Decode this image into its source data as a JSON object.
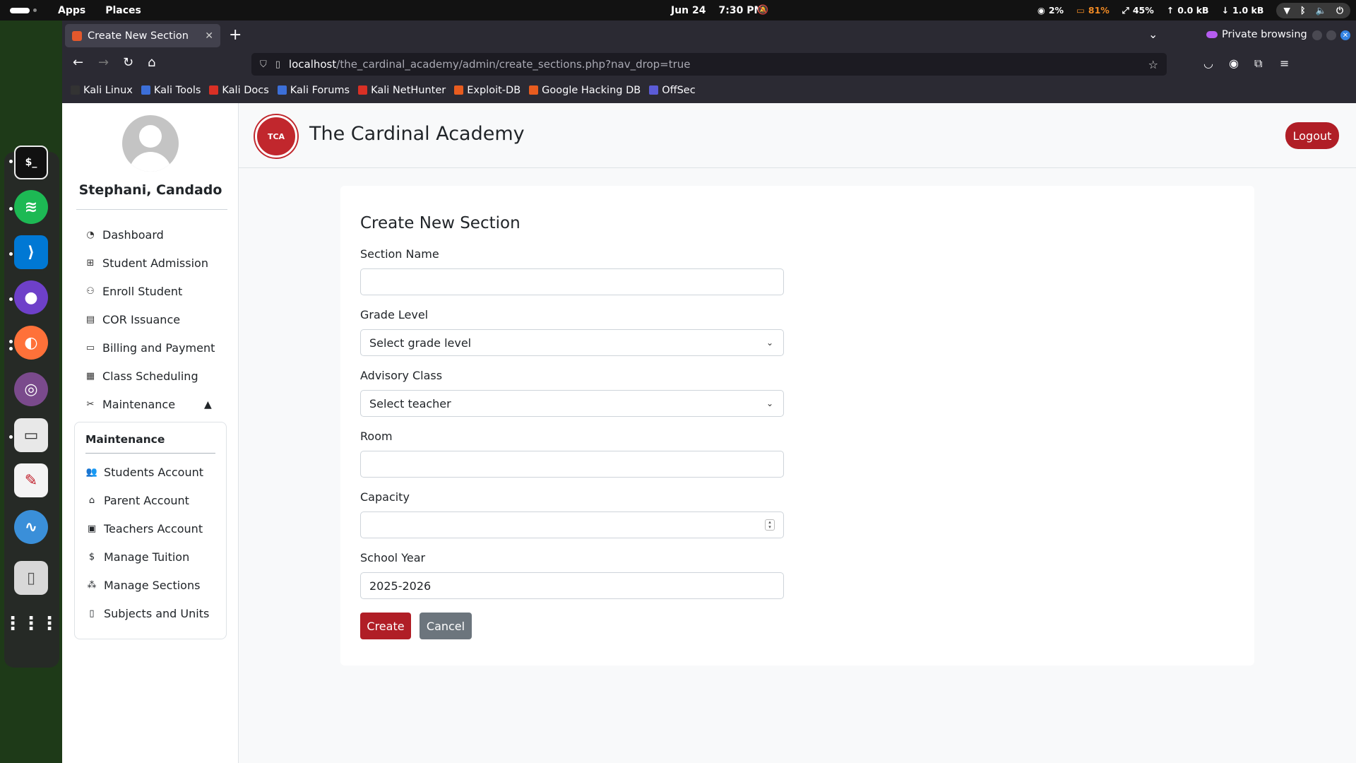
{
  "topbar": {
    "apps": "Apps",
    "places": "Places",
    "date": "Jun 24",
    "time": "7:30 PM",
    "cpu": "2%",
    "battery": "81%",
    "mem": "45%",
    "up": "0.0 kB",
    "down": "1.0 kB"
  },
  "dock": [
    "terminal-icon",
    "spotify-icon",
    "vscode-icon",
    "github-icon",
    "firefox-icon",
    "media-icon",
    "files-icon",
    "text-editor-icon",
    "wireshark-icon",
    "trash-icon",
    "app-grid-icon"
  ],
  "browser": {
    "tab_title": "Create New Section",
    "private_label": "Private browsing",
    "url_host": "localhost",
    "url_path": "/the_cardinal_academy/admin/create_sections.php?nav_drop=true",
    "bookmarks": [
      "Kali Linux",
      "Kali Tools",
      "Kali Docs",
      "Kali Forums",
      "Kali NetHunter",
      "Exploit-DB",
      "Google Hacking DB",
      "OffSec"
    ],
    "bookmark_colors": [
      "#333333",
      "#3c6fd8",
      "#d93025",
      "#3c6fd8",
      "#d93025",
      "#e85c1f",
      "#e85c1f",
      "#5b5bd6"
    ]
  },
  "sidebar": {
    "user_name": "Stephani, Candado",
    "items": [
      {
        "label": "Dashboard",
        "icon": "gauge-icon"
      },
      {
        "label": "Student Admission",
        "icon": "plus-square-icon"
      },
      {
        "label": "Enroll Student",
        "icon": "person-add-icon"
      },
      {
        "label": "COR Issuance",
        "icon": "document-icon"
      },
      {
        "label": "Billing and Payment",
        "icon": "billing-icon"
      },
      {
        "label": "Class Scheduling",
        "icon": "calendar-icon"
      },
      {
        "label": "Maintenance",
        "icon": "tools-icon"
      }
    ],
    "submenu_title": "Maintenance",
    "subitems": [
      {
        "label": "Students Account",
        "icon": "people-icon"
      },
      {
        "label": "Parent Account",
        "icon": "parent-icon"
      },
      {
        "label": "Teachers Account",
        "icon": "id-card-icon"
      },
      {
        "label": "Manage Tuition",
        "icon": "dollar-icon"
      },
      {
        "label": "Manage Sections",
        "icon": "diagram-icon"
      },
      {
        "label": "Subjects and Units",
        "icon": "book-icon"
      }
    ]
  },
  "header": {
    "brand": "The Cardinal Academy",
    "logo_text": "TCA",
    "logout": "Logout"
  },
  "form": {
    "title": "Create New Section",
    "section_name_label": "Section Name",
    "section_name_value": "",
    "grade_level_label": "Grade Level",
    "grade_level_value": "Select grade level",
    "advisory_label": "Advisory Class",
    "advisory_value": "Select teacher",
    "room_label": "Room",
    "room_value": "",
    "capacity_label": "Capacity",
    "capacity_value": "",
    "school_year_label": "School Year",
    "school_year_value": "2025-2026",
    "create_btn": "Create",
    "cancel_btn": "Cancel"
  },
  "colors": {
    "brand_red": "#b01e26",
    "secondary": "#6c757d"
  }
}
